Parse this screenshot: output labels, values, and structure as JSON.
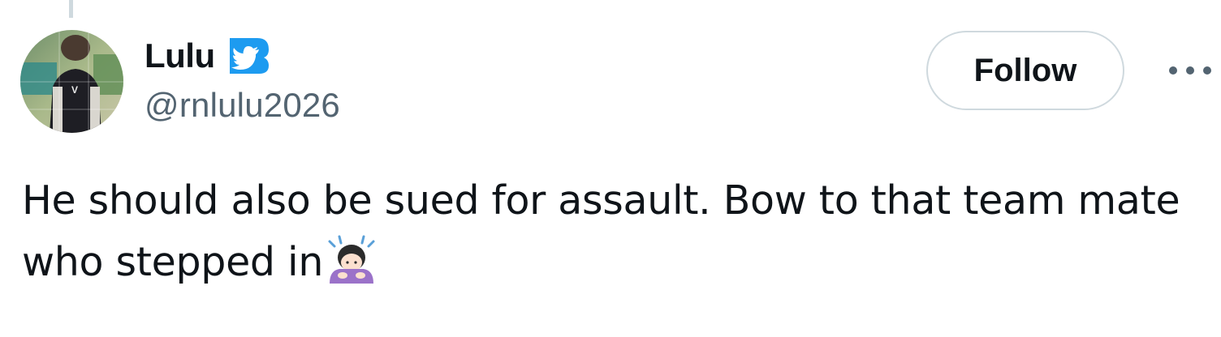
{
  "tweet": {
    "author": {
      "display_name": "Lulu",
      "handle": "@rnlulu2026",
      "verified": true,
      "avatar_icon": "profile-photo",
      "badge_icon": "blue-bird-verified-icon",
      "badge_color": "#1d9bf0"
    },
    "follow_label": "Follow",
    "more_icon": "more-horizontal-icon",
    "text_line1": "He should also be sued for assault. Bow to that team mate",
    "text_line2": "who stepped in",
    "emoji_icon": "person-bowing-emoji"
  },
  "colors": {
    "text_primary": "#0f1419",
    "text_secondary": "#536471",
    "border": "#cfd9de",
    "accent": "#1d9bf0"
  }
}
